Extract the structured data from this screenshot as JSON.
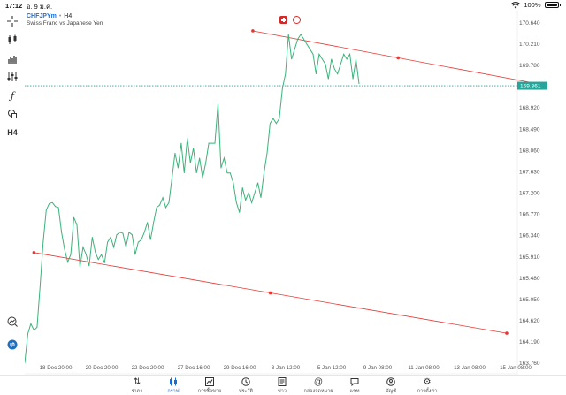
{
  "status": {
    "time": "17:12",
    "date": "อ. 9 ม.ค.",
    "battery": "100%"
  },
  "chart": {
    "symbol": "CHFJPYm",
    "separator": "•",
    "timeframe": "H4",
    "description": "Swiss Franc vs Japanese Yen",
    "current_price": "169.361",
    "colors": {
      "line": "#3bb37a",
      "trend": "#e53935",
      "price_tag": "#26a69a",
      "accent": "#1a6cd6"
    }
  },
  "toolbar": {
    "items": [
      {
        "icon": "crosshair-icon"
      },
      {
        "icon": "candles-icon"
      },
      {
        "icon": "bar-chart-icon"
      },
      {
        "icon": "indicators-icon"
      },
      {
        "icon": "function-icon"
      },
      {
        "icon": "objects-icon"
      },
      {
        "label": "H4"
      }
    ],
    "bottom_items": [
      {
        "icon": "zoom-icon"
      },
      {
        "icon": "one-click-trading-icon"
      }
    ]
  },
  "chart_data": {
    "type": "line",
    "y_ticks": [
      "170.640",
      "170.210",
      "169.780",
      "169.350",
      "168.920",
      "168.490",
      "168.060",
      "167.630",
      "167.200",
      "166.770",
      "166.340",
      "165.910",
      "165.480",
      "165.050",
      "164.620",
      "164.190",
      "163.760"
    ],
    "x_ticks": [
      "18 Dec 20:00",
      "20 Dec 20:00",
      "22 Dec 20:00",
      "27 Dec 16:00",
      "29 Dec 16:00",
      "3 Jan 12:00",
      "5 Jan 12:00",
      "9 Jan 08:00",
      "11 Jan 08:00",
      "13 Jan 08:00",
      "15 Jan 08:00"
    ],
    "ylim": [
      163.54,
      170.88
    ],
    "series": [
      {
        "values": [
          163.76,
          164.35,
          164.55,
          164.42,
          164.48,
          165.3,
          166.2,
          166.85,
          166.98,
          167.0,
          166.92,
          166.9,
          166.4,
          166.05,
          165.8,
          165.95,
          166.7,
          166.55,
          165.7,
          166.1,
          165.95,
          165.72,
          166.3,
          166.0,
          165.85,
          165.95,
          165.78,
          166.2,
          166.3,
          166.1,
          166.35,
          166.4,
          166.38,
          166.1,
          166.4,
          166.35,
          165.95,
          166.2,
          166.25,
          166.4,
          166.6,
          166.25,
          166.6,
          166.9,
          166.95,
          167.1,
          166.9,
          167.0,
          167.5,
          168.0,
          167.7,
          168.2,
          167.6,
          168.3,
          167.8,
          168.1,
          167.6,
          167.9,
          167.5,
          167.8,
          168.2,
          168.2,
          168.2,
          169.0,
          167.7,
          167.9,
          167.6,
          167.6,
          167.4,
          167.0,
          166.8,
          167.3,
          167.05,
          167.2,
          167.0,
          167.2,
          167.4,
          167.1,
          167.6,
          168.0,
          168.6,
          168.7,
          168.6,
          168.7,
          169.3,
          169.6,
          170.4,
          169.9,
          170.1,
          170.3,
          170.4,
          170.3,
          170.2,
          170.1,
          170.0,
          169.6,
          170.0,
          169.9,
          169.8,
          169.5,
          169.9,
          169.7,
          169.6,
          169.8,
          170.0,
          169.9,
          170.0,
          169.5,
          169.9,
          169.4
        ]
      }
    ],
    "trendlines": [
      {
        "x0": 124,
        "y0": 170.47,
        "x1": 282,
        "y1": 169.38
      },
      {
        "x0": 5,
        "y0": 165.99,
        "x1": 262,
        "y1": 164.36
      }
    ],
    "grid": false,
    "current_price": 169.361
  },
  "tabs": [
    {
      "label": "ราคา",
      "icon": "quotes-icon"
    },
    {
      "label": "กราฟ",
      "icon": "chart-icon",
      "active": true
    },
    {
      "label": "การซื้อขาย",
      "icon": "trade-icon"
    },
    {
      "label": "ประวัติ",
      "icon": "history-icon"
    },
    {
      "label": "ข่าว",
      "icon": "news-icon"
    },
    {
      "label": "กล่องจดหมาย",
      "icon": "mailbox-icon"
    },
    {
      "label": "แชท",
      "icon": "chat-icon"
    },
    {
      "label": "บัญชี",
      "icon": "account-icon"
    },
    {
      "label": "การตั้งค่า",
      "icon": "settings-icon"
    }
  ]
}
